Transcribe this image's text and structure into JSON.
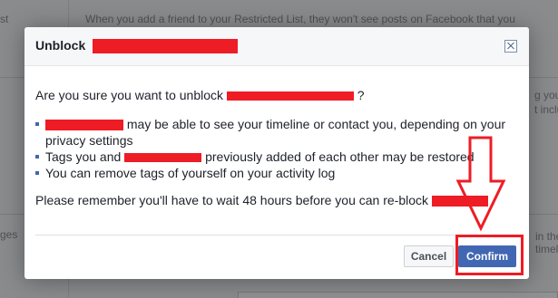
{
  "background": {
    "fragments": [
      "When you add a friend to your Restricted List, they won't see posts on Facebook that you",
      "st",
      "g you,",
      "t inclu",
      "ges",
      "in the",
      "timeli"
    ]
  },
  "dialog": {
    "title": "Unblock",
    "intro_prefix": "Are you sure you want to unblock",
    "intro_suffix": "?",
    "bullets": [
      {
        "redacted": true,
        "text": "may be able to see your timeline or contact you, depending on your privacy settings"
      },
      {
        "prefix": "Tags you and",
        "redacted": true,
        "text": "previously added of each other may be restored"
      },
      {
        "text": "You can remove tags of yourself on your activity log"
      }
    ],
    "note": "Please remember you'll have to wait 48 hours before you can re-block",
    "note_suffix": ".",
    "cancel_label": "Cancel",
    "confirm_label": "Confirm"
  },
  "colors": {
    "redaction": "#ee1c25",
    "confirm": "#4267b2"
  }
}
